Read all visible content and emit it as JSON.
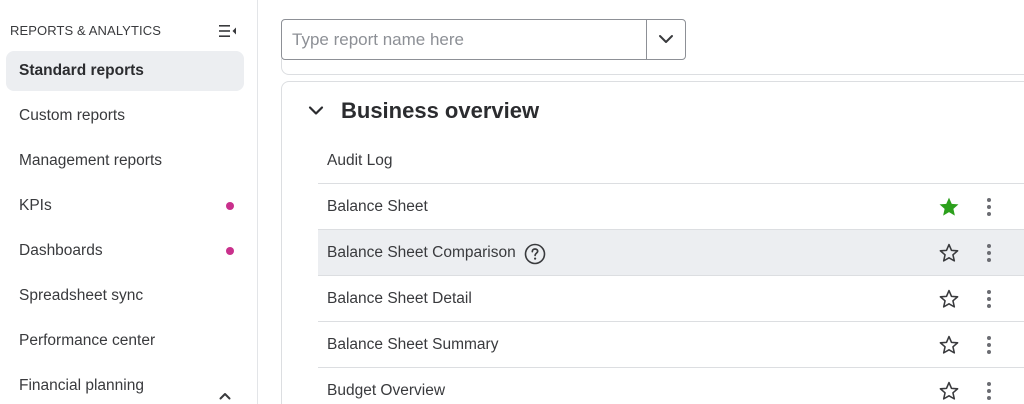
{
  "sidebar": {
    "title": "REPORTS & ANALYTICS",
    "items": [
      {
        "label": "Standard reports",
        "active": true
      },
      {
        "label": "Custom reports"
      },
      {
        "label": "Management reports"
      },
      {
        "label": "KPIs",
        "badge": "dot"
      },
      {
        "label": "Dashboards",
        "badge": "dot"
      },
      {
        "label": "Spreadsheet sync"
      },
      {
        "label": "Performance center"
      },
      {
        "label": "Financial planning",
        "expanded": true
      }
    ]
  },
  "search": {
    "placeholder": "Type report name here",
    "value": ""
  },
  "section": {
    "title": "Business overview",
    "rows": [
      {
        "label": "Audit Log"
      },
      {
        "label": "Balance Sheet",
        "favorite": true
      },
      {
        "label": "Balance Sheet Comparison",
        "help": true,
        "favorite": false
      },
      {
        "label": "Balance Sheet Detail",
        "favorite": false
      },
      {
        "label": "Balance Sheet Summary",
        "favorite": false
      },
      {
        "label": "Budget Overview",
        "favorite": false
      }
    ]
  },
  "colors": {
    "accent_green": "#2ca01c",
    "badge_magenta": "#c9308c",
    "active_bg": "#eceef1"
  },
  "icons": {
    "collapse": "collapse-sidebar-icon",
    "dropdown": "chevron-down-icon",
    "favorite": "star-icon",
    "more": "kebab-menu-icon",
    "help": "question-mark-icon"
  }
}
